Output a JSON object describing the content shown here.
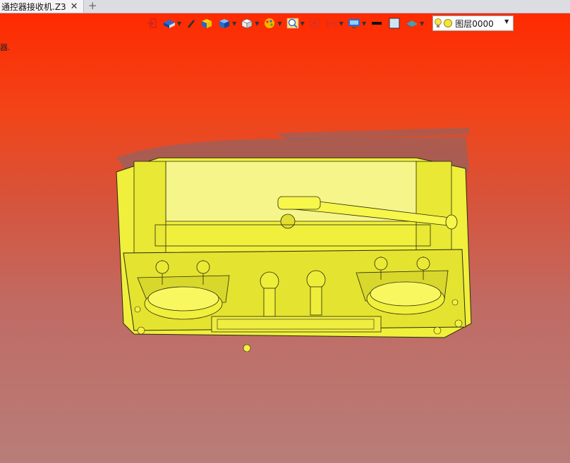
{
  "tab": {
    "title": "通控器接收机.Z3",
    "close": "✕",
    "add": "+"
  },
  "viewport": {
    "side_text": "器."
  },
  "toolbar": {
    "icons": [
      "exit-icon",
      "render-mode-icon",
      "pen-icon",
      "box-yellow-icon",
      "cube-blue-icon",
      "cube-white-icon",
      "color-palette-icon",
      "zoom-icon",
      "fit-view-icon",
      "section-plane-icon",
      "display-settings-icon",
      "line-black-icon",
      "square-fill-icon",
      "plane-icon"
    ],
    "layer": {
      "name": "图层0000"
    }
  },
  "colors": {
    "bg_top": "#ff2a00",
    "bg_bottom": "#b87d78",
    "model_yellow": "#f0ef3c",
    "model_edge": "#2a2a10"
  }
}
